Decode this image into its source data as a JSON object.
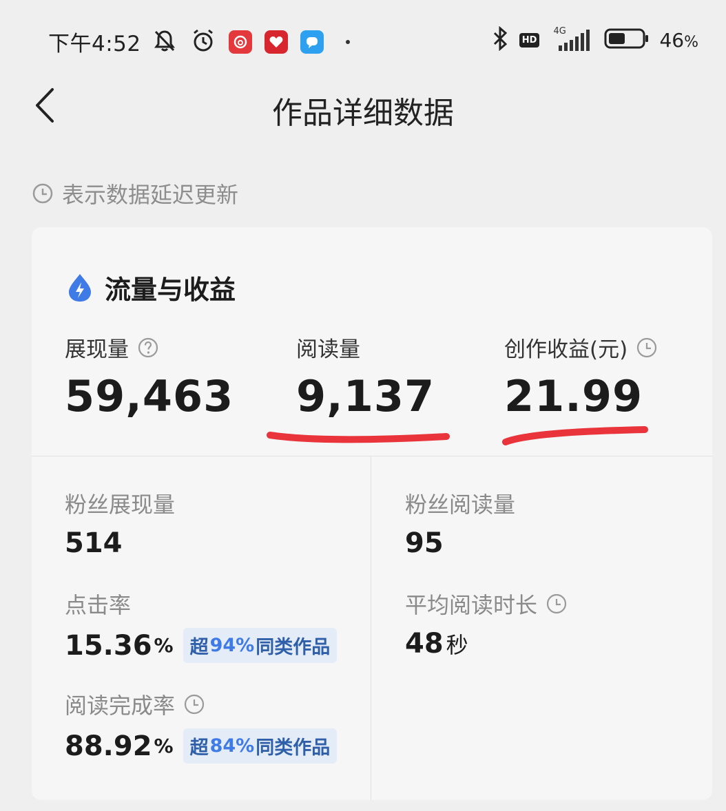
{
  "status_bar": {
    "time": "下午4:52",
    "network": "4G",
    "hd": "HD",
    "battery_value": "46",
    "battery_unit": "%"
  },
  "nav": {
    "title": "作品详细数据"
  },
  "delay_note": "表示数据延迟更新",
  "card": {
    "title": "流量与收益",
    "top_metrics": [
      {
        "label": "展现量",
        "value": "59,463"
      },
      {
        "label": "阅读量",
        "value": "9,137"
      },
      {
        "label": "创作收益(元)",
        "value": "21.99"
      }
    ],
    "metrics": {
      "fan_impressions": {
        "label": "粉丝展现量",
        "value": "514"
      },
      "fan_reads": {
        "label": "粉丝阅读量",
        "value": "95"
      },
      "ctr": {
        "label": "点击率",
        "value": "15.36",
        "unit": "%",
        "badge_prefix": "超",
        "badge_pct": "94%",
        "badge_suffix": "同类作品"
      },
      "avg_read_time": {
        "label": "平均阅读时长",
        "value": "48",
        "unit": "秒"
      },
      "completion_rate": {
        "label": "阅读完成率",
        "value": "88.92",
        "unit": "%",
        "badge_prefix": "超",
        "badge_pct": "84%",
        "badge_suffix": "同类作品"
      }
    }
  },
  "colors": {
    "accent_blue": "#3f7be6",
    "annotation_red": "#e8343a",
    "background": "#efefef",
    "card": "#f6f6f6"
  }
}
